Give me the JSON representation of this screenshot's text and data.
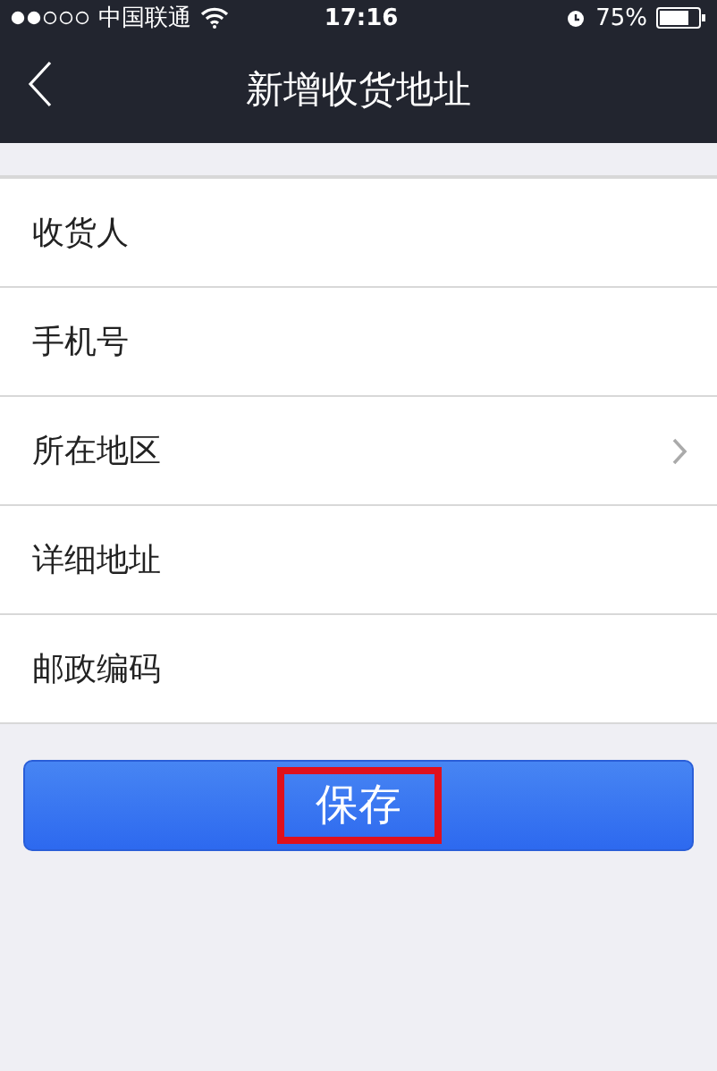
{
  "status_bar": {
    "carrier": "中国联通",
    "time": "17:16",
    "battery": "75%"
  },
  "nav": {
    "title": "新增收货地址"
  },
  "fields": [
    {
      "label": "收货人",
      "kind": "input"
    },
    {
      "label": "手机号",
      "kind": "input"
    },
    {
      "label": "所在地区",
      "kind": "select"
    },
    {
      "label": "详细地址",
      "kind": "input"
    },
    {
      "label": "邮政编码",
      "kind": "input"
    }
  ],
  "save_button": {
    "label": "保存",
    "highlighted": true
  }
}
